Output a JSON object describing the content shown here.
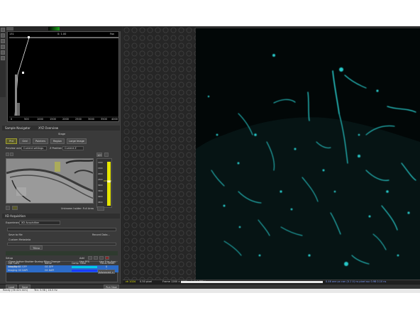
{
  "colors": {
    "accent_yellow": "#e6e600",
    "lane_cyan": "#00c8e6",
    "lane_blue": "#1a3cff",
    "selection": "#2d6cc8",
    "vessel": "#28c8c8"
  },
  "histogram": {
    "top_left": "131",
    "top_center": "0: 1.00",
    "top_right": "Fan",
    "x_ticks": [
      "0",
      "500",
      "1000",
      "1500",
      "2000",
      "2500",
      "3000",
      "3500",
      "4000"
    ]
  },
  "sample_nav": {
    "header": "Sample Navigator",
    "tab2": "XYZ Overview",
    "title": "Stage",
    "mode_buttons": [
      "Prd",
      "Grid",
      "Pointers",
      "Region",
      "Large Image"
    ],
    "preview_label": "Preview using",
    "preview_value": "Current settings",
    "zpos_label": "Z Position",
    "zpos_value": "Current Z",
    "unknown_holder": "Unknown holder: Full Area",
    "zoom_value": "10%",
    "z_ticks": [
      "1000",
      "1500",
      "2000",
      "2500",
      "3000",
      "3500",
      "4000",
      "4500"
    ]
  },
  "acq": {
    "header": "XD Acquisition",
    "experiment_label": "Experiment",
    "experiment_value": "XD Acquisition",
    "save_to_file": "Save to file",
    "custom_metadata": "Custom Metadata",
    "record_data": "Record Data...",
    "tiling": "Tiling",
    "setup_label": "Setup",
    "add_label": "Add",
    "columns": [
      "Opt. Conf.",
      "Name",
      "Comp. Color",
      "Focus Offset"
    ],
    "rows": [
      {
        "conf": "Imaging GS GFP",
        "name": "GS GFP",
        "offset": "0"
      },
      {
        "conf": "Imaging GS DAPI",
        "name": "GS DAPI",
        "offset": "0"
      }
    ],
    "close_shutter": "Close Active Shutter During Filter Change",
    "use_pfs": "Use PFS",
    "use_trig": "Use Trig. Acq.",
    "use_bent": "Use Bent",
    "advanced": "Advanced >>",
    "load": "Load",
    "save": "Save",
    "run_now": "Run Now"
  },
  "viewer": {
    "status_left": "ch 1024",
    "status_zoom": "0.50 pixel",
    "status_size": "Frame 1280 × 1170 × 1 (0.0 MB)",
    "status_fmt": "16bit",
    "status_right": "0.46  one px can (0.1 V) ns pixel ssc 0.98 0.10 ns"
  },
  "bottombar": {
    "left": "Ready (36 mm mm)",
    "mid": "Ten: 5.98 | 16.5 Hz"
  }
}
